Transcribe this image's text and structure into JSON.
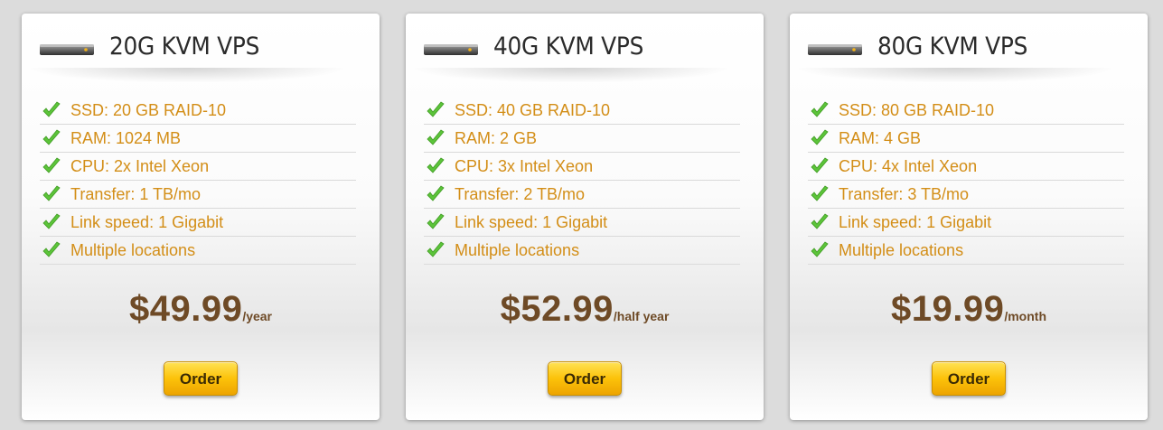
{
  "plans": [
    {
      "title": "20G KVM VPS",
      "features": [
        "SSD: 20 GB RAID-10",
        "RAM: 1024 MB",
        "CPU: 2x Intel Xeon",
        "Transfer: 1 TB/mo",
        "Link speed: 1 Gigabit",
        "Multiple locations"
      ],
      "price": "$49.99",
      "period": "/year",
      "order_label": "Order"
    },
    {
      "title": "40G KVM VPS",
      "features": [
        "SSD: 40 GB RAID-10",
        "RAM: 2 GB",
        "CPU: 3x Intel Xeon",
        "Transfer: 2 TB/mo",
        "Link speed: 1 Gigabit",
        "Multiple locations"
      ],
      "price": "$52.99",
      "period": "/half year",
      "order_label": "Order"
    },
    {
      "title": "80G KVM VPS",
      "features": [
        "SSD: 80 GB RAID-10",
        "RAM: 4 GB",
        "CPU: 4x Intel Xeon",
        "Transfer: 3 TB/mo",
        "Link speed: 1 Gigabit",
        "Multiple locations"
      ],
      "price": "$19.99",
      "period": "/month",
      "order_label": "Order"
    }
  ],
  "icons": {
    "header": "server-icon",
    "feature": "checkmark-icon"
  },
  "colors": {
    "feature_text": "#d38e17",
    "price_text": "#6e4a26",
    "button": "#fcc20a",
    "check": "#5cc43a"
  }
}
